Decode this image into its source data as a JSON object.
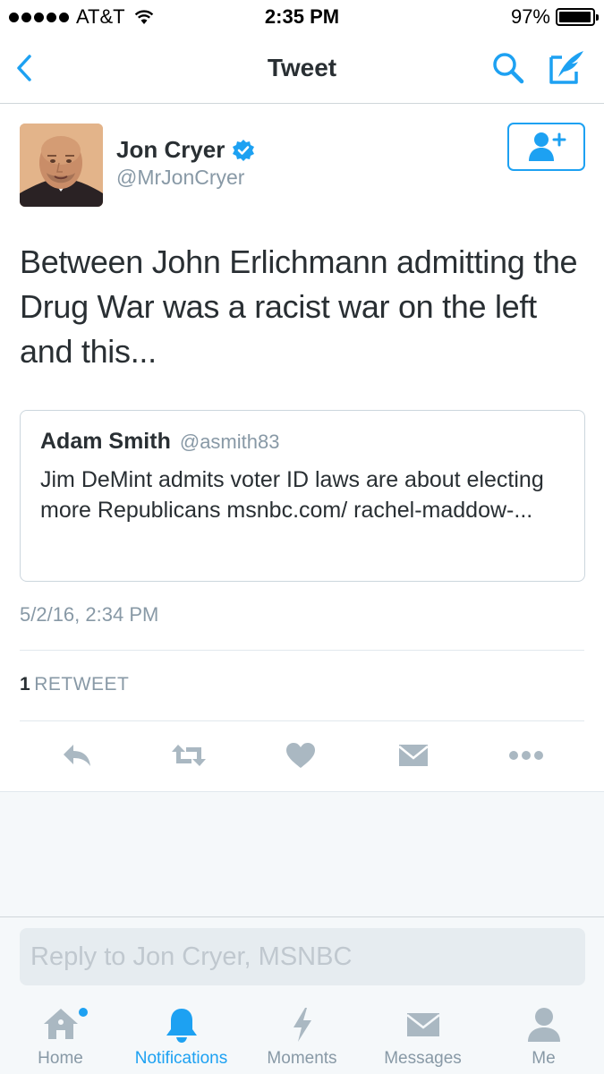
{
  "status_bar": {
    "carrier": "AT&T",
    "time": "2:35 PM",
    "battery": "97%",
    "battery_level": 0.97
  },
  "nav": {
    "title": "Tweet",
    "icons": [
      "back-chevron-icon",
      "search-icon",
      "compose-tweet-icon"
    ]
  },
  "tweet": {
    "author_name": "Jon Cryer",
    "author_handle": "@MrJonCryer",
    "verified": true,
    "text": "Between John Erlichmann admitting the Drug War was a racist war on the left and this...",
    "timestamp": "5/2/16, 2:34 PM",
    "retweet_count": "1",
    "retweet_label": "RETWEET"
  },
  "quoted_tweet": {
    "author_name": "Adam Smith",
    "author_handle": "@asmith83",
    "text": "Jim DeMint admits voter ID laws are about electing more Republicans msnbc.com/ rachel-maddow-..."
  },
  "actions": [
    "reply-icon",
    "retweet-icon",
    "like-heart-icon",
    "direct-message-icon",
    "more-icon"
  ],
  "reply": {
    "placeholder": "Reply to Jon Cryer, MSNBC"
  },
  "tabs": [
    {
      "label": "Home",
      "icon": "home-icon",
      "active": false,
      "has_dot": true
    },
    {
      "label": "Notifications",
      "icon": "bell-icon",
      "active": true
    },
    {
      "label": "Moments",
      "icon": "lightning-icon",
      "active": false
    },
    {
      "label": "Messages",
      "icon": "envelope-icon",
      "active": false
    },
    {
      "label": "Me",
      "icon": "person-icon",
      "active": false
    }
  ],
  "colors": {
    "accent": "#1da1f2",
    "text": "#292f33",
    "secondary_text": "#8899a6",
    "action_icon": "#aab8c2",
    "background_grey": "#f5f8fa"
  }
}
